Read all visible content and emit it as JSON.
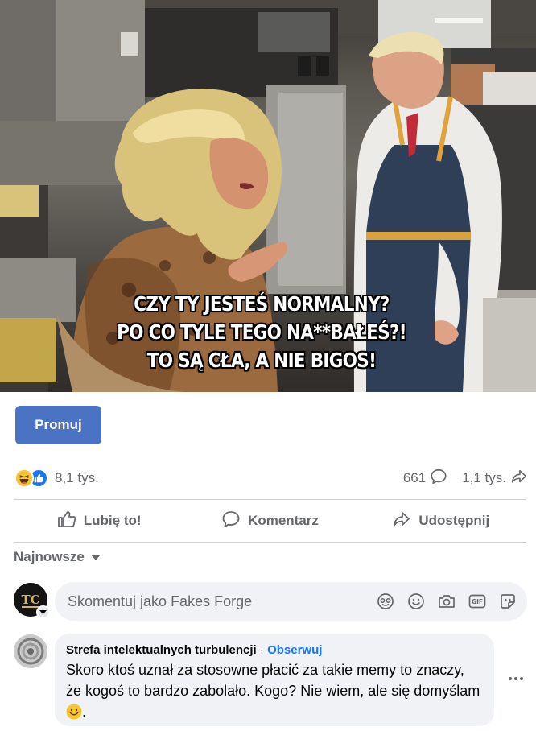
{
  "post": {
    "image": {
      "caption_lines": [
        "CZY TY JESTEŚ NORMALNY?",
        "PO CO TYLE TEGO NA**BAŁEŚ?!",
        "TO SĄ CŁA, A NIE BIGOS!"
      ]
    },
    "promote_label": "Promuj",
    "reactions": {
      "icons": [
        "haha-icon",
        "like-icon"
      ],
      "count": "8,1 tys."
    },
    "comments_count": "661",
    "shares_count": "1,1 tys.",
    "actions": {
      "like": "Lubię to!",
      "comment": "Komentarz",
      "share": "Udostępnij"
    }
  },
  "comments": {
    "sort_label": "Najnowsze",
    "composer": {
      "placeholder": "Skomentuj jako Fakes Forge",
      "avatar_text": "TC",
      "tools": [
        "avatar-sticker-icon",
        "emoji-icon",
        "camera-icon",
        "gif-icon",
        "sticker-icon"
      ]
    },
    "items": [
      {
        "author": "Strefa intelektualnych turbulencji",
        "separator": "·",
        "follow": "Obserwuj",
        "text": "Skoro ktoś uznał za stosowne płacić za takie memy to znaczy, że kogoś to bardzo zabolało. Kogo? Nie wiem, ale się domyślam",
        "text_end": "."
      }
    ]
  },
  "colors": {
    "primary_button": "#4b73c4",
    "link": "#1877f2",
    "secondary_text": "#65676b",
    "bubble": "#f0f2f5"
  }
}
